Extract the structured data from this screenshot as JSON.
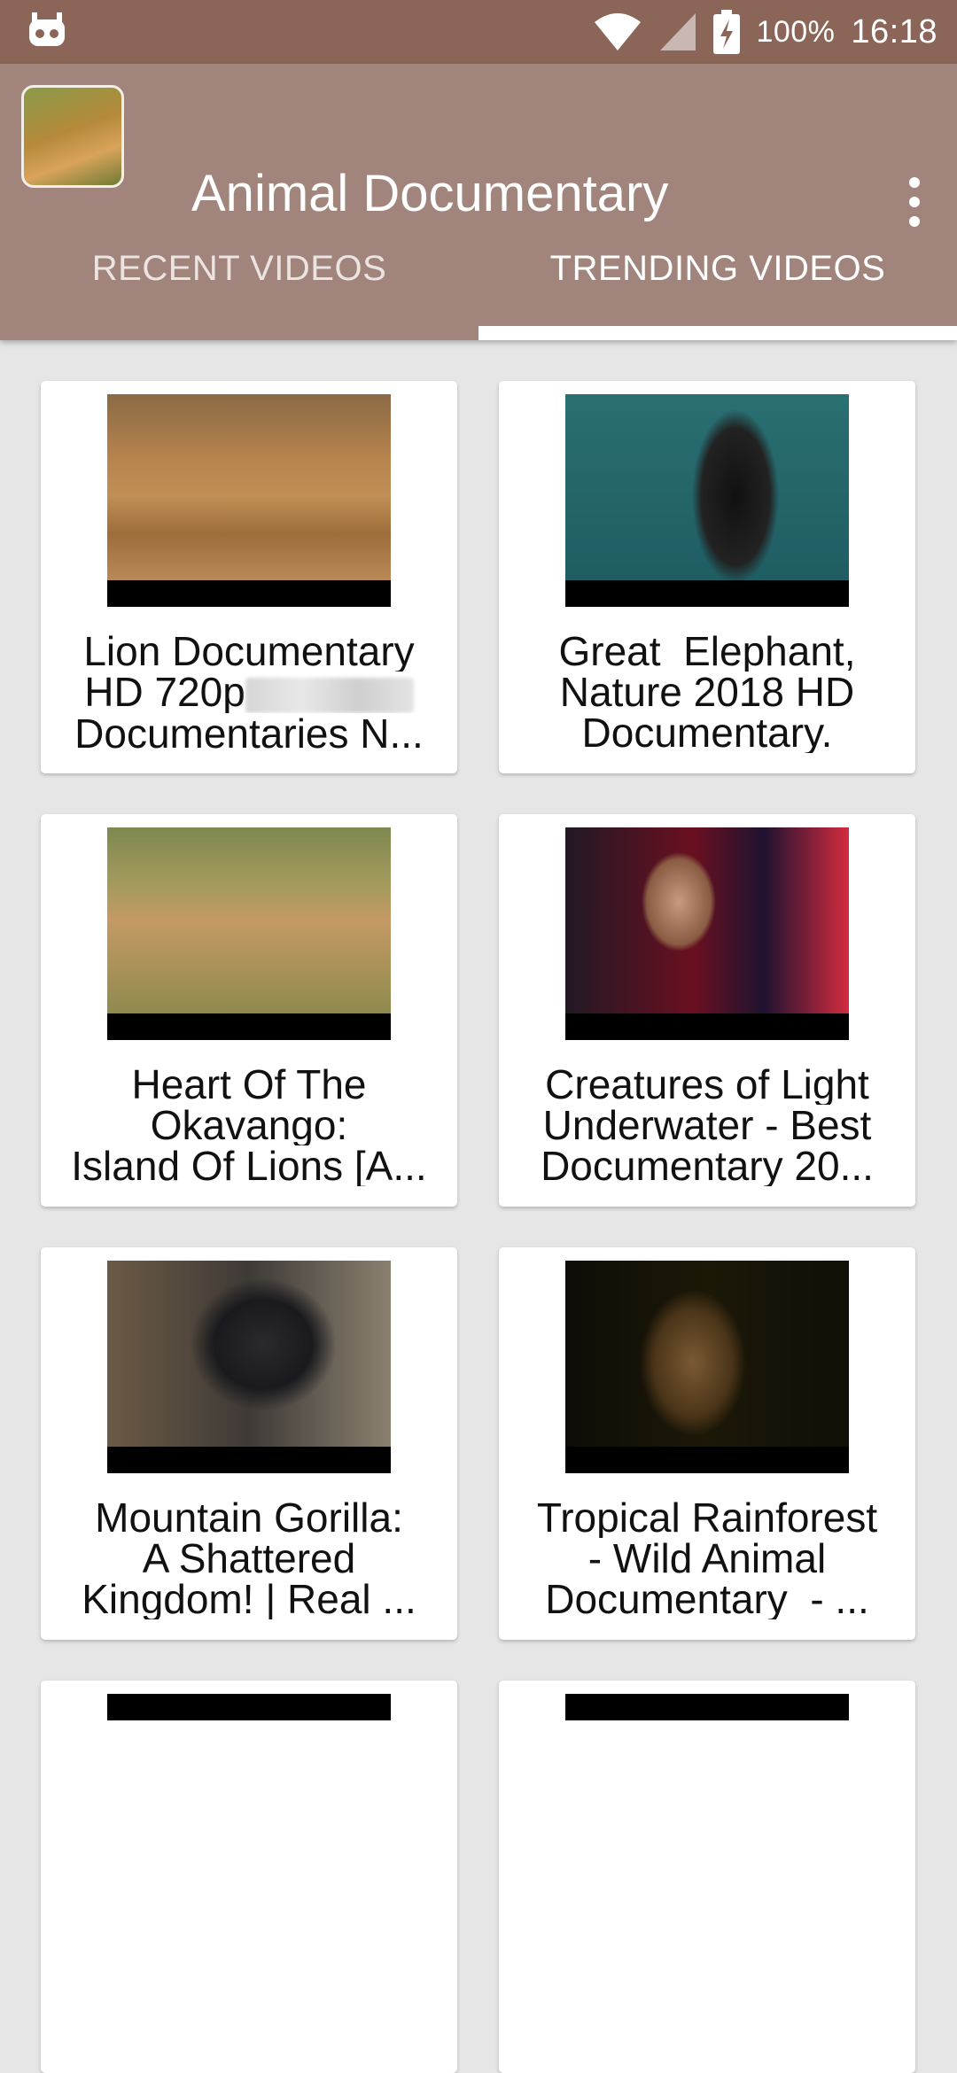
{
  "status_bar": {
    "battery_percent": "100%",
    "time": "16:18",
    "icons": [
      "app-notification-icon",
      "wifi-icon",
      "signal-icon",
      "battery-charging-icon"
    ]
  },
  "app_bar": {
    "title": "Animal Documentary",
    "overflow_icon": "more-vert-icon"
  },
  "tabs": [
    {
      "label": "RECENT VIDEOS",
      "active": false
    },
    {
      "label": "TRENDING VIDEOS",
      "active": true
    }
  ],
  "videos": [
    {
      "title_lines": [
        "Lion Documentary",
        "HD 720p",
        "Documentaries N..."
      ]
    },
    {
      "title_lines": [
        "Great  Elephant,",
        "Nature 2018 HD",
        "Documentary."
      ]
    },
    {
      "title_lines": [
        "Heart Of The",
        "Okavango:",
        "Island Of Lions [A..."
      ]
    },
    {
      "title_lines": [
        "Creatures of Light",
        "Underwater - Best",
        "Documentary 20..."
      ]
    },
    {
      "title_lines": [
        "Mountain Gorilla:",
        "A Shattered",
        "Kingdom! | Real ..."
      ]
    },
    {
      "title_lines": [
        "Tropical Rainforest",
        "- Wild Animal",
        "Documentary  - ..."
      ]
    }
  ],
  "colors": {
    "status_bar": "#8b6558",
    "app_bar": "#a1847b",
    "background": "#e6e6e6",
    "card": "#ffffff"
  }
}
